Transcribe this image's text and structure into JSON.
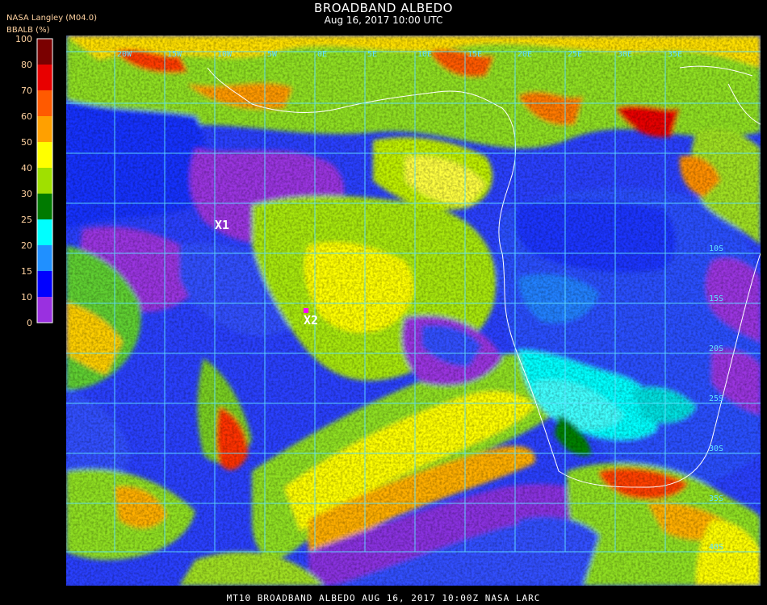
{
  "header": {
    "title": "BROADBAND ALBEDO",
    "subtitle": "Aug 16, 2017 10:00 UTC",
    "producer": "NASA Langley (M04.0)",
    "variable": "BBALB (%)"
  },
  "colorbar": {
    "ticks": [
      "100",
      "80",
      "70",
      "60",
      "50",
      "40",
      "30",
      "25",
      "20",
      "15",
      "10",
      "0"
    ],
    "colors": [
      "#7a0000",
      "#e80000",
      "#ff5a00",
      "#ffa000",
      "#ffff00",
      "#a0e000",
      "#007a00",
      "#00ffff",
      "#2090ff",
      "#0000ff",
      "#9a30e0"
    ]
  },
  "map": {
    "lon_labels": [
      "20W",
      "15W",
      "10W",
      "5W",
      "0E",
      "5E",
      "10E",
      "15E",
      "20E",
      "25E",
      "30E",
      "35E"
    ],
    "lat_labels": [
      "10S",
      "15S",
      "20S",
      "25S",
      "30S",
      "35S",
      "40S"
    ],
    "markers": [
      {
        "label": "X1"
      },
      {
        "label": "X2"
      }
    ],
    "grid_color": "#60e0ff",
    "coast_color": "#ffffff"
  },
  "footer": {
    "text": "MT10  BROADBAND ALBEDO   AUG 16, 2017 10:00Z   NASA LARC"
  }
}
